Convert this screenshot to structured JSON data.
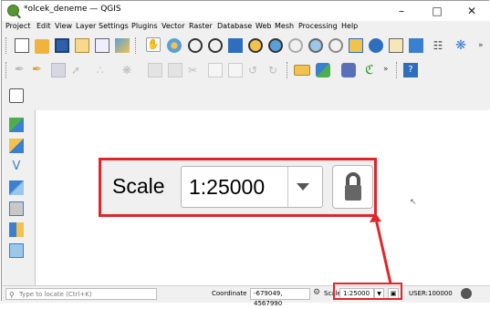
{
  "window": {
    "title": "*olcek_deneme — QGIS"
  },
  "menu": [
    "Project",
    "Edit",
    "View",
    "Layer",
    "Settings",
    "Plugins",
    "Vector",
    "Raster",
    "Database",
    "Web",
    "Mesh",
    "Processing",
    "Help"
  ],
  "toolbar_overflow": "»",
  "zoom_callout": {
    "label": "Scale",
    "value": "1:25000"
  },
  "statusbar": {
    "locator_placeholder": "Type to locate (Ctrl+K)",
    "coordinate_label": "Coordinate",
    "coordinate_value": "-679049, 4567990",
    "scale_label": "Scale",
    "scale_value": "1:25000",
    "crs": "USER:100000"
  },
  "colors": {
    "highlight": "#e0262b",
    "qgis_green": "#589632"
  }
}
